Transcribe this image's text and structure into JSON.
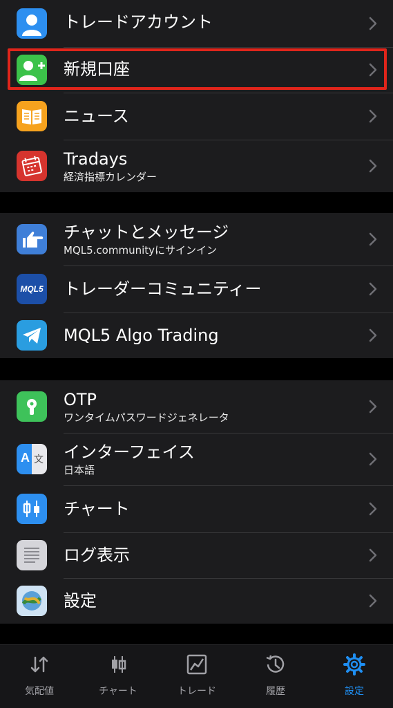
{
  "groups": [
    {
      "items": [
        {
          "title": "トレードアカウント",
          "subtitle": "",
          "icon": "person-icon",
          "color": "#2d8ff0"
        },
        {
          "title": "新規口座",
          "subtitle": "",
          "icon": "add-person-icon",
          "color": "#3cc24a"
        },
        {
          "title": "ニュース",
          "subtitle": "",
          "icon": "book-icon",
          "color": "#f6a21e"
        },
        {
          "title": "Tradays",
          "subtitle": "経済指標カレンダー",
          "icon": "calendar-icon",
          "color": "#d6342e"
        }
      ]
    },
    {
      "items": [
        {
          "title": "チャットとメッセージ",
          "subtitle": "MQL5.communityにサインイン",
          "icon": "pointing-hand-icon",
          "color": "#3f7fd8"
        },
        {
          "title": "トレーダーコミュニティー",
          "subtitle": "",
          "icon": "mql5-logo-icon",
          "color": "#1c4fa8"
        },
        {
          "title": "MQL5 Algo Trading",
          "subtitle": "",
          "icon": "telegram-icon",
          "color": "#2a9de0"
        }
      ]
    },
    {
      "items": [
        {
          "title": "OTP",
          "subtitle": "ワンタイムパスワードジェネレータ",
          "icon": "keyhole-icon",
          "color": "#3ec25a"
        },
        {
          "title": "インターフェイス",
          "subtitle": "日本語",
          "icon": "translate-icon",
          "color": "#2d8ff0"
        },
        {
          "title": "チャート",
          "subtitle": "",
          "icon": "candlestick-icon",
          "color": "#2d8ff0"
        },
        {
          "title": "ログ表示",
          "subtitle": "",
          "icon": "document-icon",
          "color": "#d5d5da"
        },
        {
          "title": "設定",
          "subtitle": "",
          "icon": "mt-logo-icon",
          "color": "#5aa0d8"
        }
      ]
    }
  ],
  "mql5_logo_text": "MQL5",
  "translate_glyphs": [
    "A",
    "文"
  ],
  "highlighted_item": "新規口座",
  "tabs": [
    {
      "label": "気配値",
      "icon": "quotes-arrows-icon",
      "active": false
    },
    {
      "label": "チャート",
      "icon": "candlestick-icon",
      "active": false
    },
    {
      "label": "トレード",
      "icon": "trade-chart-icon",
      "active": false
    },
    {
      "label": "履歴",
      "icon": "history-clock-icon",
      "active": false
    },
    {
      "label": "設定",
      "icon": "gear-icon",
      "active": true
    }
  ],
  "colors": {
    "accent": "#1f8ef1",
    "highlight": "#e0251b",
    "cell_bg": "#1c1c1e",
    "inactive_tab": "#a1a1a6"
  }
}
